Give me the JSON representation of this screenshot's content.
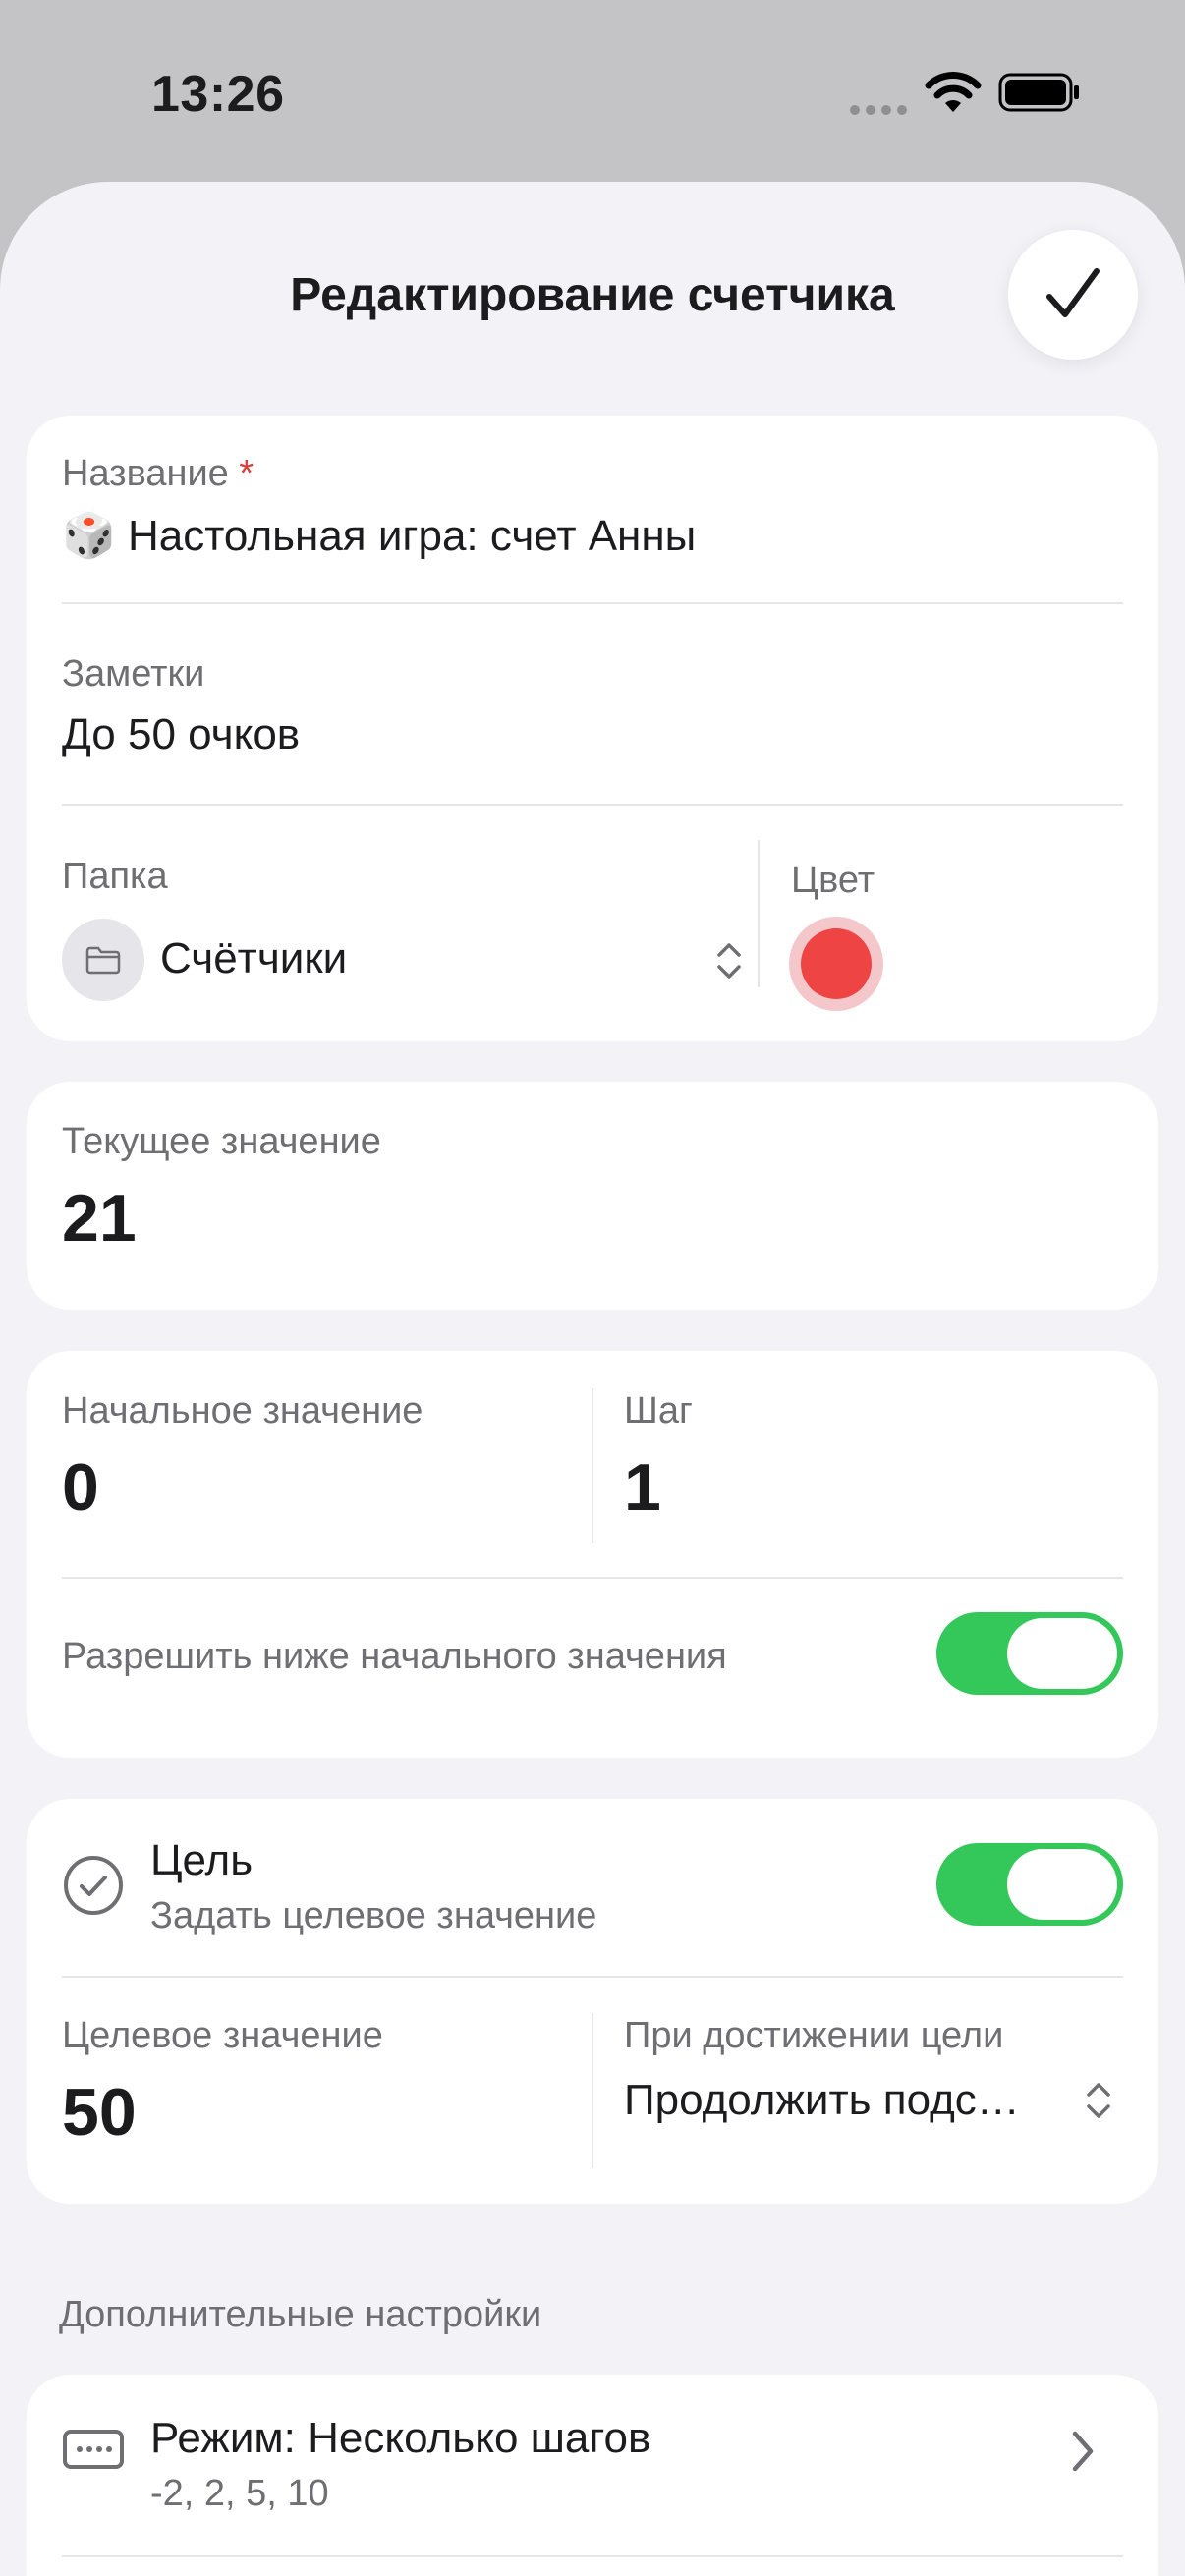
{
  "status_bar": {
    "time": "13:26"
  },
  "header": {
    "title": "Редактирование счетчика"
  },
  "name_field": {
    "label": "Название",
    "required_mark": "*",
    "emoji": "🎲",
    "value": "Настольная игра: счет Анны"
  },
  "notes_field": {
    "label": "Заметки",
    "value": "До 50 очков"
  },
  "folder_field": {
    "label": "Папка",
    "value": "Счётчики"
  },
  "color_field": {
    "label": "Цвет",
    "selected_color": "#ee4444"
  },
  "current_value": {
    "label": "Текущее значение",
    "value": "21"
  },
  "initial_value": {
    "label": "Начальное значение",
    "value": "0"
  },
  "step": {
    "label": "Шаг",
    "value": "1"
  },
  "allow_below": {
    "label": "Разрешить ниже начального значения",
    "enabled": true
  },
  "goal": {
    "title": "Цель",
    "subtitle": "Задать целевое значение",
    "enabled": true
  },
  "target_value": {
    "label": "Целевое значение",
    "value": "50"
  },
  "on_goal": {
    "label": "При достижении цели",
    "value": "Продолжить подс…"
  },
  "additional": {
    "header": "Дополнительные настройки",
    "mode_title": "Режим: Несколько шагов",
    "mode_subtitle": "-2, 2, 5, 10"
  },
  "colors": {
    "accent_green": "#34c759",
    "sheet_bg": "#f2f2f7"
  }
}
